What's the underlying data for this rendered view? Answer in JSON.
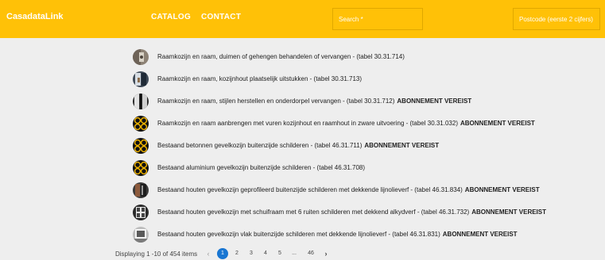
{
  "header": {
    "brand": "CasadataLink",
    "nav": [
      "CATALOG",
      "CONTACT"
    ],
    "search_placeholder": "Search *",
    "postcode_placeholder": "Postcode (eerste 2 cijfers)",
    "bg_color": "#ffc107"
  },
  "items": [
    {
      "title": "Raamkozijn en raam, duimen of gehengen behandelen of vervangen - (tabel 30.31.714)",
      "badge": "",
      "icon": "hinge-photo-icon"
    },
    {
      "title": "Raamkozijn en raam, kozijnhout plaatselijk uitstukken - (tabel 30.31.713)",
      "badge": "",
      "icon": "window-frame-photo-icon"
    },
    {
      "title": "Raamkozijn en raam, stijlen herstellen en onderdorpel vervangen - (tabel 30.31.712)",
      "badge": "ABONNEMENT VEREIST",
      "icon": "window-sill-photo-icon"
    },
    {
      "title": "Raamkozijn en raam aanbrengen met vuren kozijnhout en raamhout in zware uitvoering - (tabel 30.31.032)",
      "badge": "ABONNEMENT VEREIST",
      "icon": "casadata-logo-icon"
    },
    {
      "title": "Bestaand betonnen gevelkozijn buitenzijde schilderen - (tabel 46.31.711)",
      "badge": "ABONNEMENT VEREIST",
      "icon": "casadata-logo-icon"
    },
    {
      "title": "Bestaand aluminium gevelkozijn buitenzijde schilderen - (tabel 46.31.708)",
      "badge": "",
      "icon": "casadata-logo-icon"
    },
    {
      "title": "Bestaand houten gevelkozijn geprofileerd buitenzijde schilderen met dekkende lijnolieverf - (tabel 46.31.834)",
      "badge": "ABONNEMENT VEREIST",
      "icon": "painted-frame-photo-icon"
    },
    {
      "title": "Bestaand houten gevelkozijn met schuifraam met 6 ruiten schilderen met dekkend alkydverf - (tabel 46.31.732)",
      "badge": "ABONNEMENT VEREIST",
      "icon": "sash-window-photo-icon"
    },
    {
      "title": "Bestaand houten gevelkozijn vlak buitenzijde schilderen met dekkende lijnolieverf - (tabel 46.31.831)",
      "badge": "ABONNEMENT VEREIST",
      "icon": "flat-frame-photo-icon"
    }
  ],
  "pagination": {
    "info": "Displaying 1 -10 of 454 items",
    "prev": "‹",
    "pages": [
      "1",
      "2",
      "3",
      "4",
      "5",
      "...",
      "46"
    ],
    "next": "›",
    "current_page": "1",
    "active_color": "#1976d2"
  }
}
